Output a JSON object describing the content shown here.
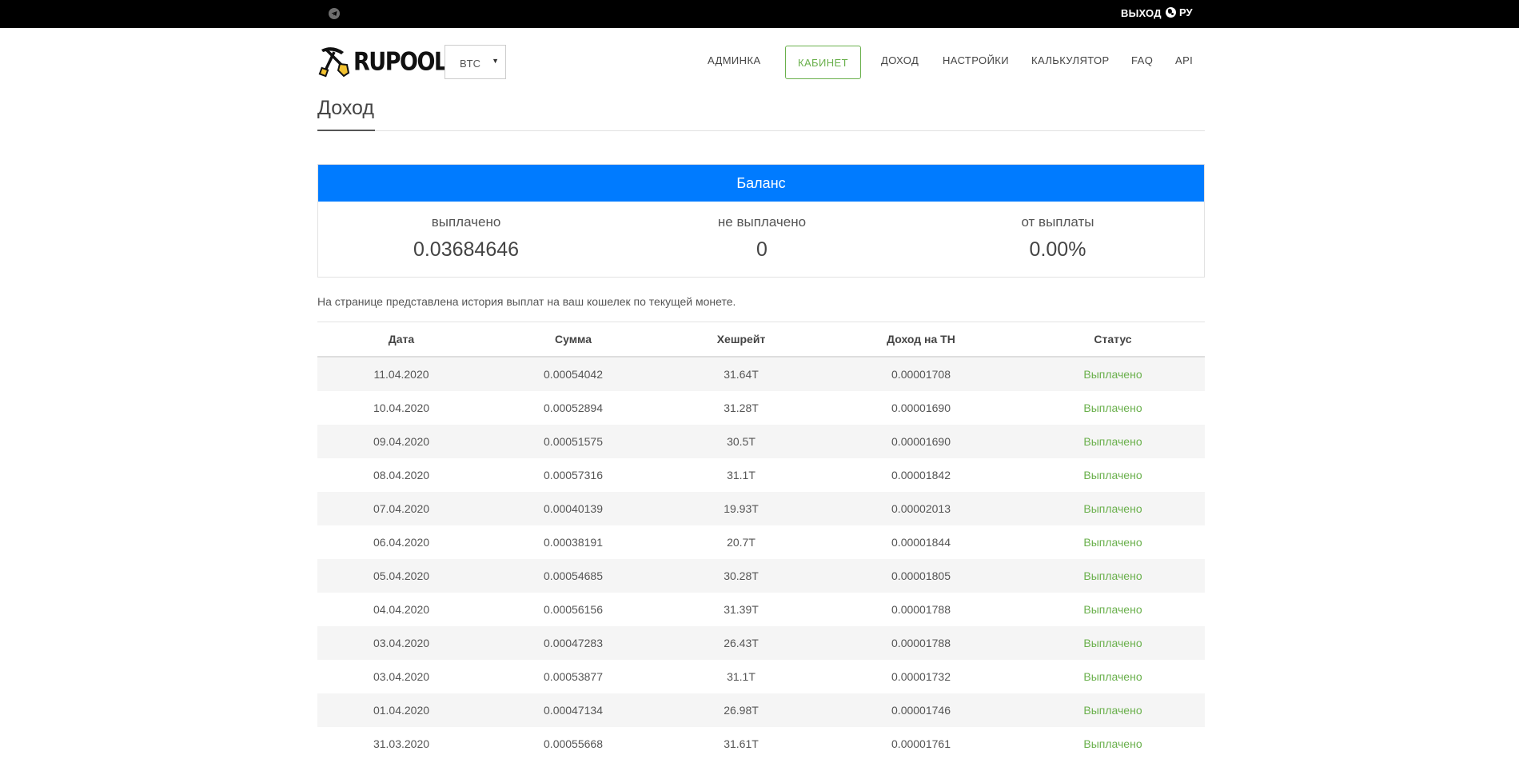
{
  "topbar": {
    "telegram_icon": "telegram-icon",
    "logout_label": "ВЫХОД",
    "lang_icon": "globe-icon",
    "lang_label": "РУ"
  },
  "header": {
    "logo_text": "RUPOOL",
    "logo_icon": "pickaxe-shovel-icon",
    "coin_select": "BTC",
    "nav": [
      {
        "label": "АДМИНКА",
        "active": false
      },
      {
        "label": "КАБИНЕТ",
        "active": true
      },
      {
        "label": "ДОХОД",
        "active": false
      },
      {
        "label": "НАСТРОЙКИ",
        "active": false
      },
      {
        "label": "КАЛЬКУЛЯТОР",
        "active": false
      },
      {
        "label": "FAQ",
        "active": false
      },
      {
        "label": "API",
        "active": false
      }
    ]
  },
  "page": {
    "title": "Доход"
  },
  "balance": {
    "title": "Баланс",
    "paid_label": "выплачено",
    "paid_value": "0.03684646",
    "unpaid_label": "не выплачено",
    "unpaid_value": "0",
    "progress_label": "от выплаты",
    "progress_value": "0.00%"
  },
  "description": "На странице представлена история выплат на ваш кошелек по текущей монете.",
  "table": {
    "headers": [
      "Дата",
      "Сумма",
      "Хешрейт",
      "Доход на TH",
      "Статус"
    ],
    "rows": [
      [
        "11.04.2020",
        "0.00054042",
        "31.64T",
        "0.00001708",
        "Выплачено"
      ],
      [
        "10.04.2020",
        "0.00052894",
        "31.28T",
        "0.00001690",
        "Выплачено"
      ],
      [
        "09.04.2020",
        "0.00051575",
        "30.5T",
        "0.00001690",
        "Выплачено"
      ],
      [
        "08.04.2020",
        "0.00057316",
        "31.1T",
        "0.00001842",
        "Выплачено"
      ],
      [
        "07.04.2020",
        "0.00040139",
        "19.93T",
        "0.00002013",
        "Выплачено"
      ],
      [
        "06.04.2020",
        "0.00038191",
        "20.7T",
        "0.00001844",
        "Выплачено"
      ],
      [
        "05.04.2020",
        "0.00054685",
        "30.28T",
        "0.00001805",
        "Выплачено"
      ],
      [
        "04.04.2020",
        "0.00056156",
        "31.39T",
        "0.00001788",
        "Выплачено"
      ],
      [
        "03.04.2020",
        "0.00047283",
        "26.43T",
        "0.00001788",
        "Выплачено"
      ],
      [
        "03.04.2020",
        "0.00053877",
        "31.1T",
        "0.00001732",
        "Выплачено"
      ],
      [
        "01.04.2020",
        "0.00047134",
        "26.98T",
        "0.00001746",
        "Выплачено"
      ],
      [
        "31.03.2020",
        "0.00055668",
        "31.61T",
        "0.00001761",
        "Выплачено"
      ]
    ]
  },
  "colors": {
    "accent_blue": "#007bff",
    "status_green": "#6ab04c",
    "topbar": "#000000"
  }
}
